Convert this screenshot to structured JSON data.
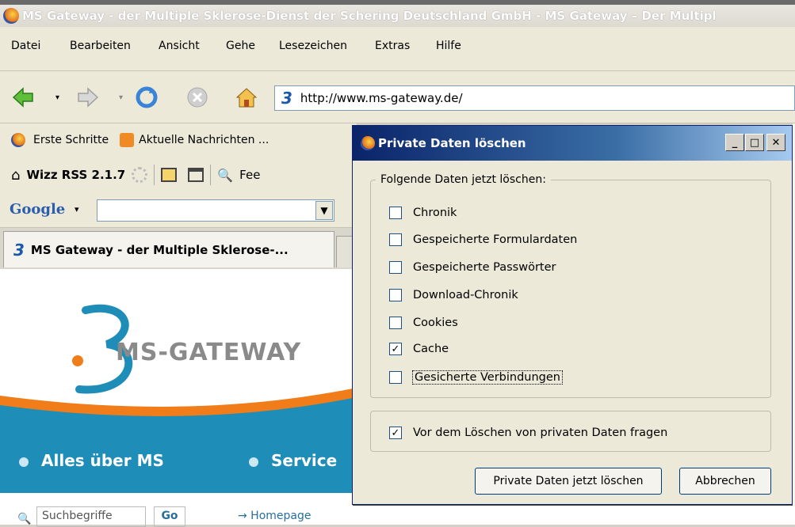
{
  "window": {
    "title": "MS Gateway - der Multiple Sklerose-Dienst der Schering Deutschland GmbH - MS Gateway – Der Multipl"
  },
  "menu": [
    {
      "label": "Datei"
    },
    {
      "label": "Bearbeiten"
    },
    {
      "label": "Ansicht"
    },
    {
      "label": "Gehe"
    },
    {
      "label": "Lesezeichen"
    },
    {
      "label": "Extras"
    },
    {
      "label": "Hilfe"
    }
  ],
  "nav": {
    "url": "http://www.ms-gateway.de/"
  },
  "bookmarks": {
    "first": "Erste Schritte",
    "news": "Aktuelle Nachrichten ..."
  },
  "wizz": {
    "label": "Wizz RSS 2.1.7",
    "feed": "Fee"
  },
  "google": {
    "label": "Google",
    "search_value": ""
  },
  "tab": {
    "label": "MS Gateway - der Multiple Sklerose-..."
  },
  "site": {
    "logo": "MS-GATEWAY",
    "nav1": "Alles über MS",
    "nav2": "Service",
    "search_placeholder": "Suchbegriffe",
    "go": "Go",
    "homepage": "→ Homepage"
  },
  "dialog": {
    "title": "Private Daten löschen",
    "group1": "Folgende Daten jetzt löschen:",
    "items": [
      {
        "label": "Chronik",
        "checked": false
      },
      {
        "label": "Gespeicherte Formulardaten",
        "checked": false
      },
      {
        "label": "Gespeicherte Passwörter",
        "checked": false
      },
      {
        "label": "Download-Chronik",
        "checked": false
      },
      {
        "label": "Cookies",
        "checked": false
      },
      {
        "label": "Cache",
        "checked": true
      },
      {
        "label": "Gesicherte Verbindungen",
        "checked": false
      }
    ],
    "ask": {
      "label": "Vor dem Löschen von privaten Daten fragen",
      "checked": true
    },
    "ok": "Private Daten jetzt löschen",
    "cancel": "Abbrechen"
  },
  "colors": {
    "title_blue": "#0a246a",
    "site_teal": "#1e8db8",
    "site_orange": "#f07d1a"
  }
}
